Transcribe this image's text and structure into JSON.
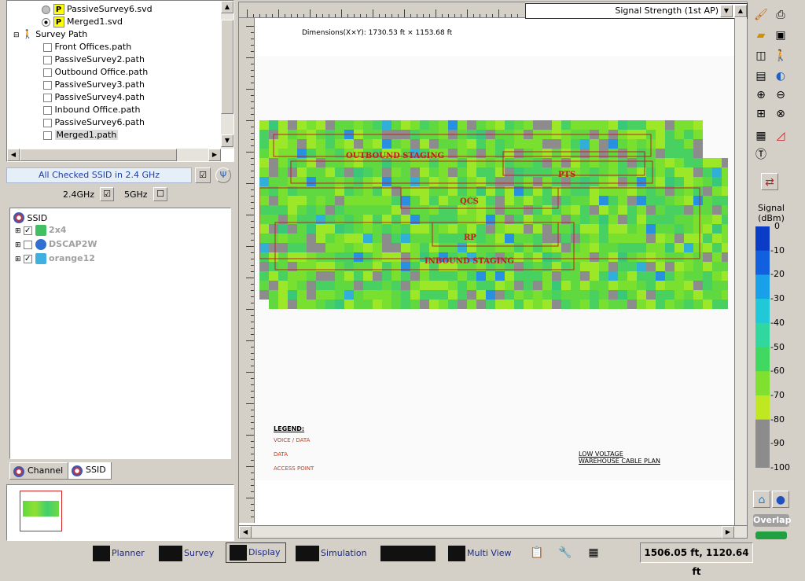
{
  "survey_tree": {
    "rows": [
      {
        "label": "PassiveSurvey6.svd",
        "kind": "svd",
        "selected": false
      },
      {
        "label": "Merged1.svd",
        "kind": "svd",
        "selected": true
      },
      {
        "label": "Survey Path",
        "kind": "group"
      },
      {
        "label": "Front Offices.path",
        "kind": "path"
      },
      {
        "label": "PassiveSurvey2.path",
        "kind": "path"
      },
      {
        "label": "Outbound Office.path",
        "kind": "path"
      },
      {
        "label": "PassiveSurvey3.path",
        "kind": "path"
      },
      {
        "label": "PassiveSurvey4.path",
        "kind": "path"
      },
      {
        "label": "Inbound Office.path",
        "kind": "path"
      },
      {
        "label": "PassiveSurvey6.path",
        "kind": "path"
      },
      {
        "label": "Merged1.path",
        "kind": "path",
        "highlighted": true
      }
    ],
    "badge": "P"
  },
  "ssid_panel": {
    "header": "All Checked SSID in 2.4 GHz",
    "band_24": "2.4GHz",
    "band_5": "5GHz",
    "root": "SSID",
    "items": [
      {
        "label": "2x4",
        "checked": true
      },
      {
        "label": "DSCAP2W",
        "checked": false
      },
      {
        "label": "orange12",
        "checked": true
      }
    ]
  },
  "tabs": {
    "channel": "Channel",
    "ssid": "SSID"
  },
  "map": {
    "combo": "Signal Strength (1st AP)",
    "dimensions": "Dimensions(X×Y): 1730.53 ft × 1153.68 ft",
    "zones": [
      "OUTBOUND STAGING",
      "PTS",
      "QCS",
      "RP",
      "INBOUND STAGING"
    ],
    "legend_title": "LEGEND:",
    "legend_items": [
      "VOICE / DATA",
      "DATA",
      "ACCESS POINT"
    ],
    "plan_title_1": "LOW VOLTAGE",
    "plan_title_2": "WAREHOUSE CABLE PLAN"
  },
  "signal_scale": {
    "title": "Signal\n(dBm)",
    "ticks": [
      "0",
      "-10",
      "-20",
      "-30",
      "-40",
      "-50",
      "-60",
      "-70",
      "-80",
      "-90",
      "-100"
    ],
    "colors": [
      "#0a3cc8",
      "#1060e0",
      "#18a0e8",
      "#20c8d8",
      "#30d8a0",
      "#40d860",
      "#80e030",
      "#c0e820",
      "#8c8c8c",
      "#8c8c8c",
      "#8c8c8c"
    ],
    "overlap_label": "Overlap"
  },
  "bottom": {
    "planner": "Planner",
    "survey": "Survey",
    "display": "Display",
    "simulation": "Simulation",
    "multiview": "Multi View",
    "coords": "1506.05 ft, 1120.64 ft"
  }
}
